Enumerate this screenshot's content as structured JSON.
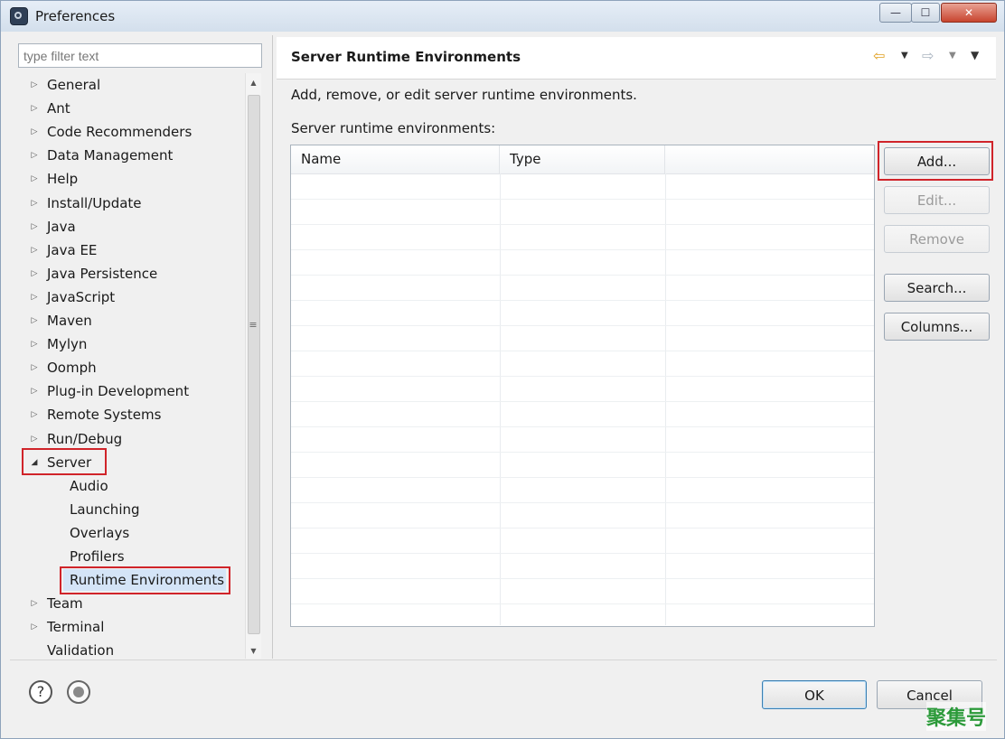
{
  "window": {
    "title": "Preferences",
    "buttons": {
      "minimize": "—",
      "maximize": "☐",
      "close": "✕"
    }
  },
  "filter": {
    "placeholder": "type filter text"
  },
  "tree": {
    "items": [
      {
        "label": "General",
        "expandable": true
      },
      {
        "label": "Ant",
        "expandable": true
      },
      {
        "label": "Code Recommenders",
        "expandable": true
      },
      {
        "label": "Data Management",
        "expandable": true
      },
      {
        "label": "Help",
        "expandable": true
      },
      {
        "label": "Install/Update",
        "expandable": true
      },
      {
        "label": "Java",
        "expandable": true
      },
      {
        "label": "Java EE",
        "expandable": true
      },
      {
        "label": "Java Persistence",
        "expandable": true
      },
      {
        "label": "JavaScript",
        "expandable": true
      },
      {
        "label": "Maven",
        "expandable": true
      },
      {
        "label": "Mylyn",
        "expandable": true
      },
      {
        "label": "Oomph",
        "expandable": true
      },
      {
        "label": "Plug-in Development",
        "expandable": true
      },
      {
        "label": "Remote Systems",
        "expandable": true
      },
      {
        "label": "Run/Debug",
        "expandable": true
      },
      {
        "label": "Server",
        "expandable": true,
        "expanded": true,
        "highlighted": true
      },
      {
        "label": "Audio",
        "child": true
      },
      {
        "label": "Launching",
        "child": true
      },
      {
        "label": "Overlays",
        "child": true
      },
      {
        "label": "Profilers",
        "child": true
      },
      {
        "label": "Runtime Environments",
        "child": true,
        "selected": true,
        "highlighted": true
      },
      {
        "label": "Team",
        "expandable": true
      },
      {
        "label": "Terminal",
        "expandable": true
      },
      {
        "label": "Validation",
        "expandable": false
      }
    ]
  },
  "page": {
    "title": "Server Runtime Environments",
    "description": "Add, remove, or edit server runtime environments.",
    "list_label": "Server runtime environments:",
    "table": {
      "columns": [
        "Name",
        "Type",
        ""
      ],
      "rows": []
    }
  },
  "icons": {
    "back": "back-arrow-icon",
    "forward": "forward-arrow-icon",
    "help": "help-icon",
    "import_export": "import-export-icon"
  },
  "buttons": {
    "add": "Add...",
    "edit": "Edit...",
    "remove": "Remove",
    "search": "Search...",
    "columns": "Columns...",
    "ok": "OK",
    "cancel": "Cancel"
  },
  "watermark": "聚集号",
  "colors": {
    "highlight_box": "#d0242a",
    "selection": "#d4e4f7",
    "ok_border": "#3c7fb1",
    "watermark": "#2c9a3a"
  }
}
